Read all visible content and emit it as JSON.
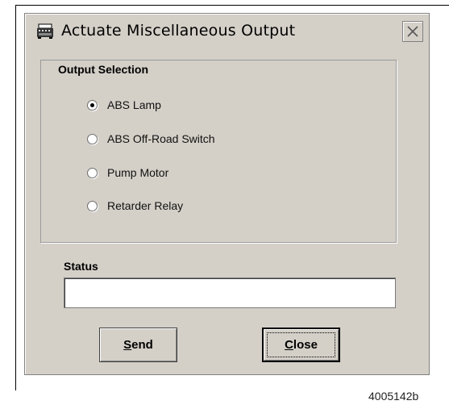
{
  "window": {
    "title": "Actuate Miscellaneous Output"
  },
  "output_selection": {
    "legend": "Output Selection",
    "options": [
      {
        "label": "ABS Lamp",
        "selected": true
      },
      {
        "label": "ABS Off-Road Switch",
        "selected": false
      },
      {
        "label": "Pump Motor",
        "selected": false
      },
      {
        "label": "Retarder Relay",
        "selected": false
      }
    ]
  },
  "status": {
    "label": "Status",
    "value": ""
  },
  "buttons": {
    "send": {
      "mnemonic": "S",
      "rest": "end"
    },
    "close": {
      "mnemonic": "C",
      "rest": "lose"
    }
  },
  "figure_id": "4005142b"
}
